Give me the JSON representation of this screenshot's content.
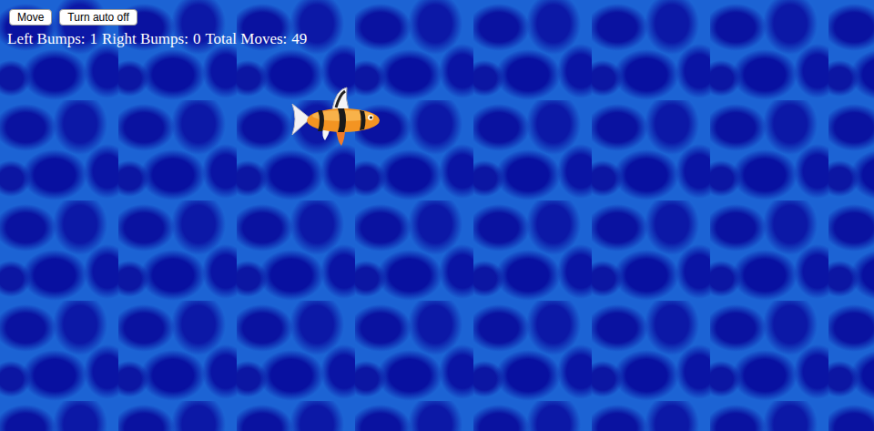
{
  "controls": {
    "buttons": [
      {
        "label": "Move"
      },
      {
        "label": "Turn auto off"
      }
    ]
  },
  "stats": [
    {
      "label": "Left Bumps:",
      "value": "1"
    },
    {
      "label": "Right Bumps:",
      "value": "0"
    },
    {
      "label": "Total Moves:",
      "value": "49"
    }
  ]
}
